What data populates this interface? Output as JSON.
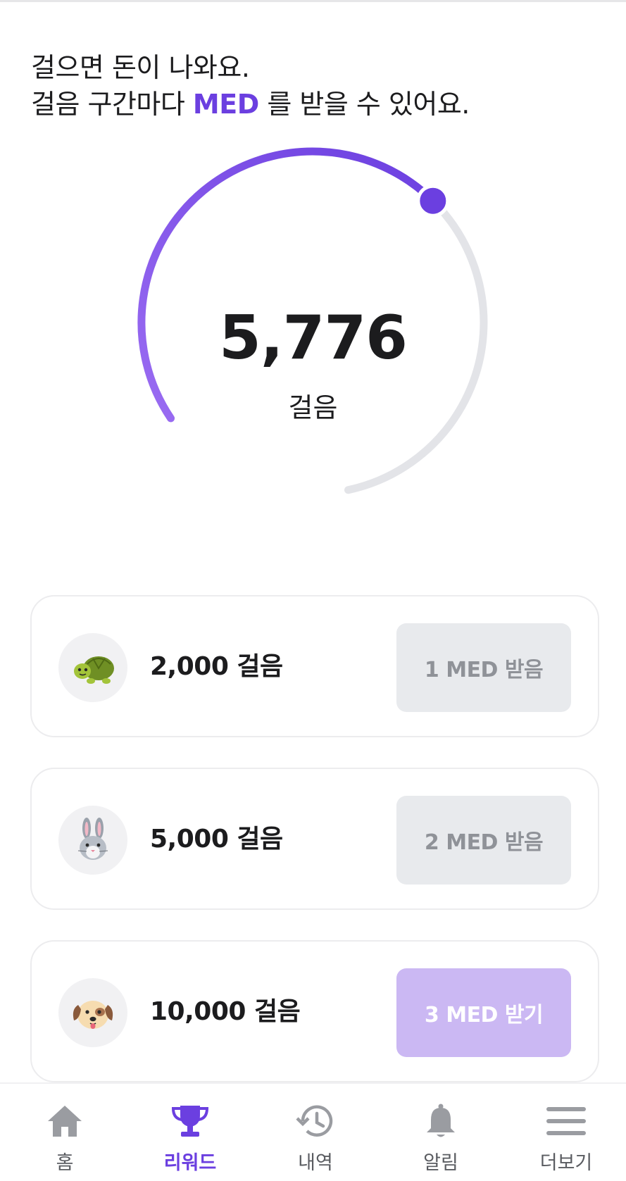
{
  "header": {
    "line1": "걸으면 돈이 나와요.",
    "line2_prefix": "걸음 구간마다 ",
    "line2_accent": "MED",
    "line2_suffix": " 를 받을 수 있어요."
  },
  "progress": {
    "steps_display": "5,776",
    "unit": "걸음",
    "fraction": 0.5776
  },
  "rewards": [
    {
      "icon": "turtle-icon",
      "goal": "2,000 걸음",
      "button": "1 MED 받음",
      "state": "received"
    },
    {
      "icon": "rabbit-icon",
      "goal": "5,000 걸음",
      "button": "2 MED 받음",
      "state": "received"
    },
    {
      "icon": "dog-icon",
      "goal": "10,000 걸음",
      "button": "3 MED 받기",
      "state": "locked"
    }
  ],
  "tabbar": {
    "active": "rewards",
    "tabs": [
      {
        "id": "home",
        "icon": "home-icon",
        "label": "홈"
      },
      {
        "id": "rewards",
        "icon": "trophy-icon",
        "label": "리워드"
      },
      {
        "id": "history",
        "icon": "history-icon",
        "label": "내역"
      },
      {
        "id": "alerts",
        "icon": "bell-icon",
        "label": "알림"
      },
      {
        "id": "more",
        "icon": "menu-icon",
        "label": "더보기"
      }
    ]
  },
  "colors": {
    "accent": "#6b3fe0",
    "accent_light": "#8f5ff0",
    "track": "#e3e4e8",
    "button_done_bg": "#e8eaed",
    "button_done_text": "#8f9298",
    "button_claim_bg": "#cbb8f3",
    "text": "#1c1c1e"
  }
}
